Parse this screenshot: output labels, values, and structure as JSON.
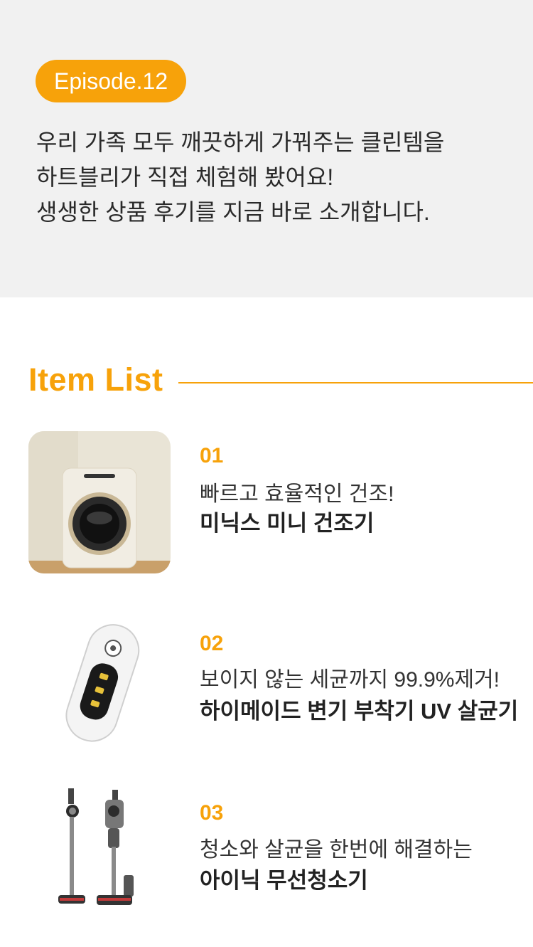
{
  "intro": {
    "badge": "Episode.12",
    "lines": [
      "우리 가족 모두 깨끗하게 가꿔주는 클린템을",
      "하트블리가 직접 체험해 봤어요!",
      "생생한 상품 후기를 지금 바로 소개합니다."
    ]
  },
  "section": {
    "title": "Item List"
  },
  "items": [
    {
      "number": "01",
      "description": "빠르고 효율적인 건조!",
      "name": "미닉스 미니 건조기"
    },
    {
      "number": "02",
      "description": "보이지 않는 세균까지 99.9%제거!",
      "name": "하이메이드 변기 부착기 UV 살균기"
    },
    {
      "number": "03",
      "description": "청소와 살균을 한번에 해결하는",
      "name": "아이닉 무선청소기"
    }
  ],
  "colors": {
    "accent": "#f7a20a",
    "intro_bg": "#f1f1f1"
  }
}
